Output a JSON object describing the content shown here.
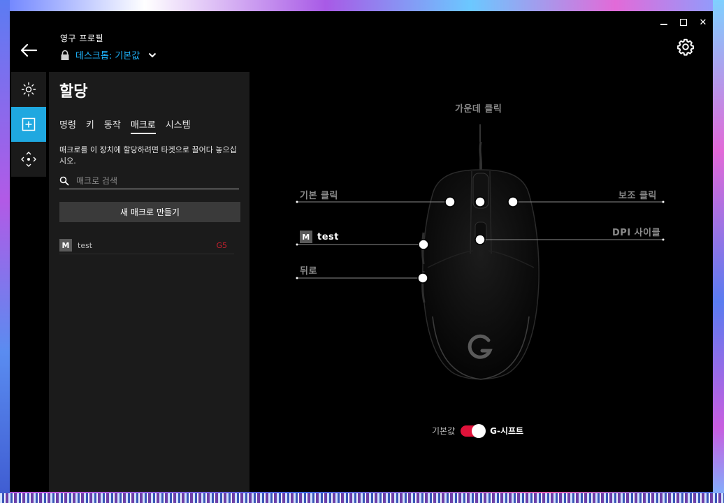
{
  "window": {
    "minimize_icon": "minimize-icon",
    "maximize_icon": "maximize-icon",
    "close_label": "✕"
  },
  "header": {
    "profile_label": "영구 프로필",
    "profile_value": "데스크톱: 기본값",
    "accent_color": "#1fb6ff"
  },
  "rail": {
    "items": [
      {
        "icon": "lighting-icon",
        "active": false
      },
      {
        "icon": "assignments-icon",
        "active": true
      },
      {
        "icon": "dpi-pointer-icon",
        "active": false
      }
    ],
    "active_color": "#1fa8e0"
  },
  "panel": {
    "title": "할당",
    "tabs": [
      {
        "label": "명령",
        "active": false
      },
      {
        "label": "키",
        "active": false
      },
      {
        "label": "동작",
        "active": false
      },
      {
        "label": "매크로",
        "active": true
      },
      {
        "label": "시스템",
        "active": false
      }
    ],
    "hint": "매크로를 이 장치에 할당하려면 타겟으로 끌어다 놓으십시오.",
    "search_placeholder": "매크로 검색",
    "new_macro_label": "새 매크로 만들기",
    "macros": [
      {
        "badge": "M",
        "name": "test",
        "key": "G5"
      }
    ]
  },
  "diagram": {
    "callouts": {
      "middle_click": "가운데 클릭",
      "left_click": "기본 클릭",
      "right_click": "보조 클릭",
      "dpi_cycle": "DPI 사이클",
      "back": "뒤로",
      "assigned_badge": "M",
      "assigned_name": "test"
    },
    "toggle": {
      "off_label": "기본값",
      "on_label": "G-시프트",
      "on": true,
      "color": "#e0123a"
    }
  }
}
